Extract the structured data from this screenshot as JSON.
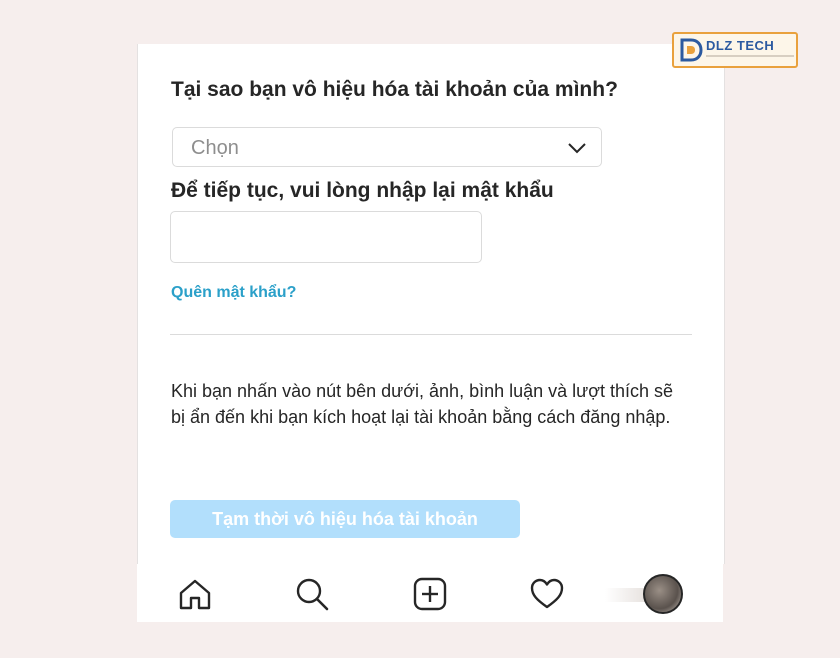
{
  "form": {
    "question": "Tại sao bạn vô hiệu hóa tài khoản của mình?",
    "reason_placeholder": "Chọn",
    "password_label": "Để tiếp tục, vui lòng nhập lại mật khẩu",
    "password_value": "",
    "forgot_link": "Quên mật khẩu?",
    "info_text": "Khi bạn nhấn vào nút bên dưới, ảnh, bình luận và lượt thích sẽ bị ẩn đến khi bạn kích hoạt lại tài khoản bằng cách đăng nhập.",
    "disable_button": "Tạm thời vô hiệu hóa tài khoản"
  },
  "tabbar": {
    "items": [
      "home-icon",
      "search-icon",
      "add-post-icon",
      "heart-icon",
      "profile-avatar"
    ]
  },
  "watermark": {
    "brand": "DLZ TECH"
  },
  "colors": {
    "text": "#262626",
    "link": "#2ba0c9",
    "button_disabled": "#b2dffc",
    "border": "#dbdbdb",
    "logo_border": "#e9a13d",
    "logo_text": "#2c5aa0"
  }
}
